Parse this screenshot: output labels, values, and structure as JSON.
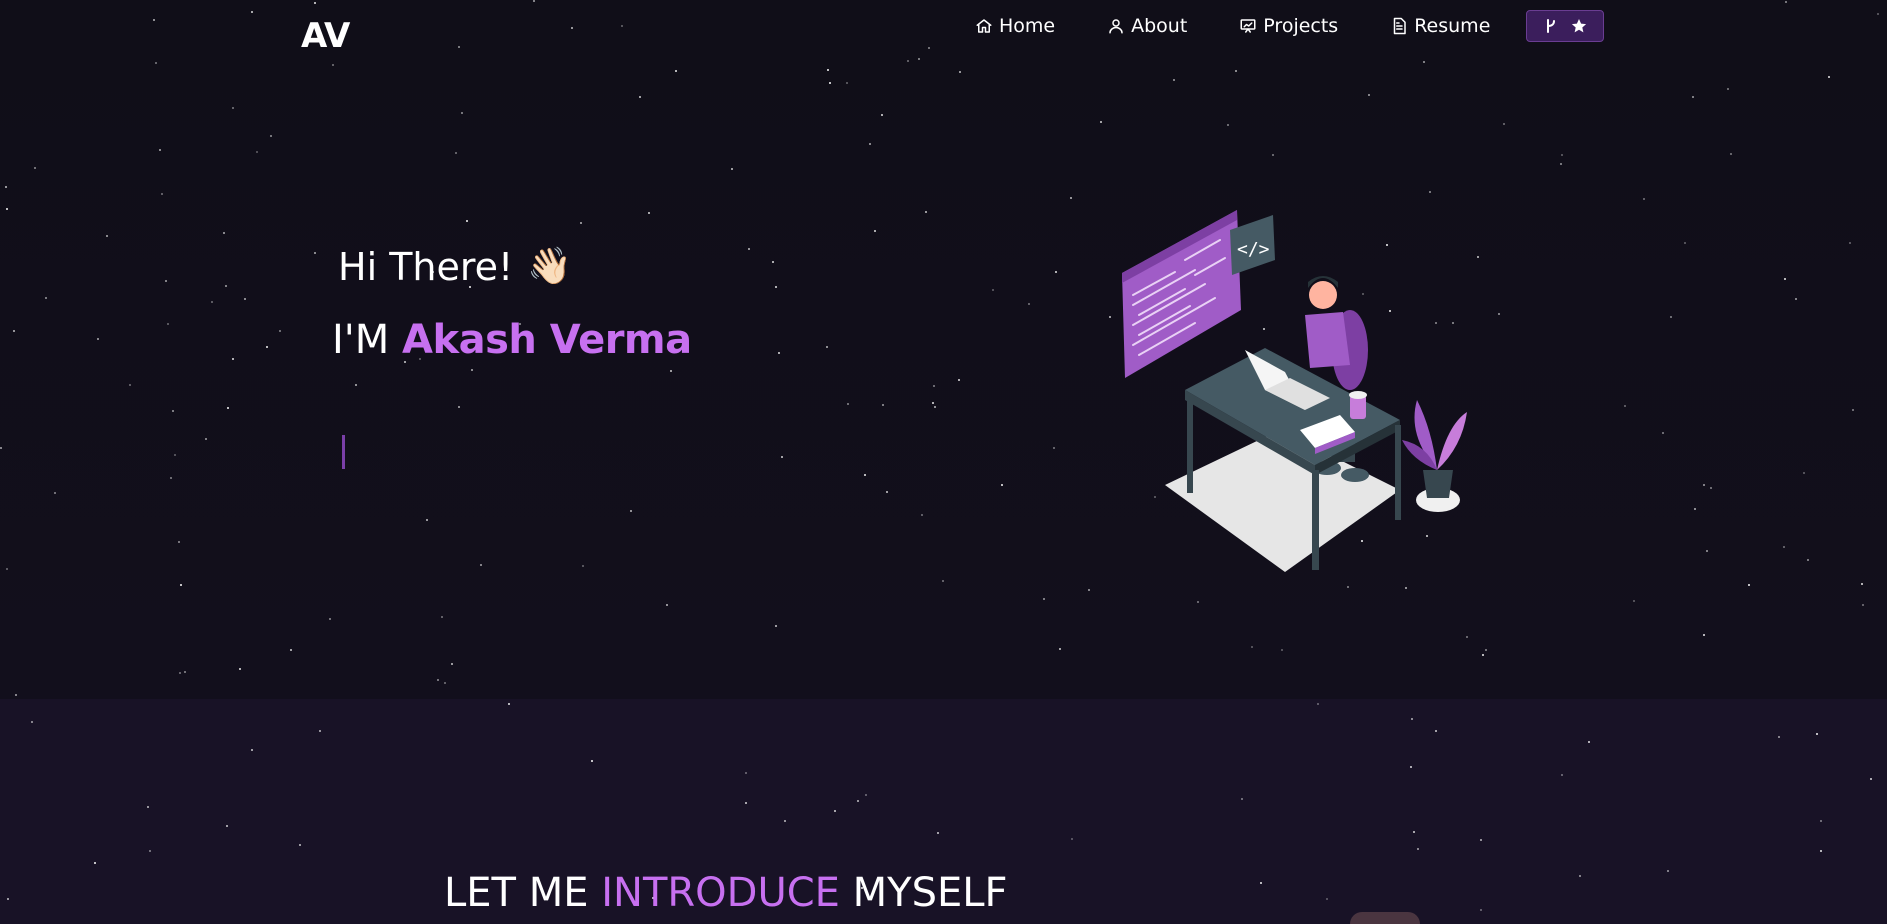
{
  "header": {
    "logo": "AV",
    "nav": [
      {
        "label": "Home",
        "icon": "home-icon"
      },
      {
        "label": "About",
        "icon": "user-icon"
      },
      {
        "label": "Projects",
        "icon": "projects-icon"
      },
      {
        "label": "Resume",
        "icon": "resume-icon"
      }
    ],
    "github_button": {
      "icons": [
        "git-fork-icon",
        "star-icon"
      ]
    }
  },
  "hero": {
    "greeting": "Hi There!",
    "wave_emoji": "👋🏻",
    "prefix": "I'M ",
    "name": "Akash Verma",
    "illustration": "developer-at-desk-illustration"
  },
  "about": {
    "heading_part1": "LET ME ",
    "heading_highlight": "INTRODUCE",
    "heading_part3": " MYSELF"
  },
  "colors": {
    "accent": "#c770f0",
    "background": "#0f0d19",
    "section_background": "#181226",
    "button_background": "#3b1e5c"
  }
}
